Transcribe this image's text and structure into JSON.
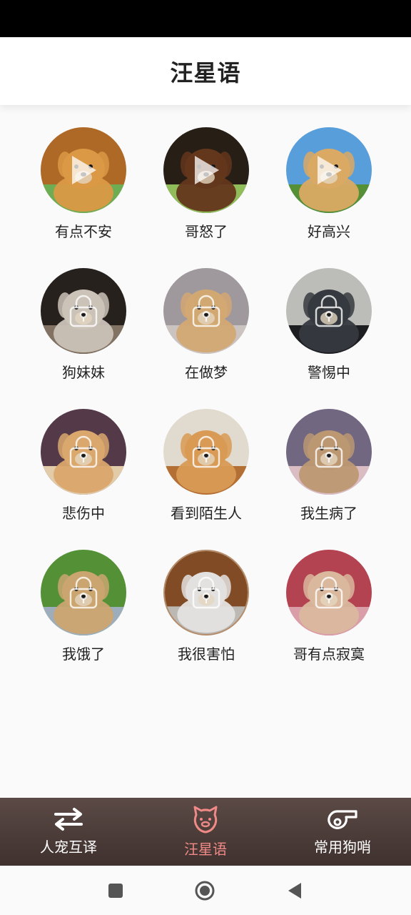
{
  "app": {
    "title": "汪星语"
  },
  "items": [
    {
      "label": "有点不安",
      "state": "play",
      "palette": [
        "#e9a24a",
        "#b9702a",
        "#74b85a"
      ]
    },
    {
      "label": "哥怒了",
      "state": "play",
      "palette": [
        "#6a3b1e",
        "#2a2018",
        "#9ac860"
      ]
    },
    {
      "label": "好高兴",
      "state": "play",
      "palette": [
        "#e8b46a",
        "#5ea8e8",
        "#5c9a3a"
      ]
    },
    {
      "label": "狗妹妹",
      "state": "locked",
      "palette": [
        "#d8cfc4",
        "#2a2420",
        "#8a7a6a"
      ]
    },
    {
      "label": "在做梦",
      "state": "locked",
      "palette": [
        "#e0b37a",
        "#a9a3a8",
        "#d8d0cc"
      ]
    },
    {
      "label": "警惕中",
      "state": "locked",
      "palette": [
        "#3a3e44",
        "#c8c8c4",
        "#1e2024"
      ]
    },
    {
      "label": "悲伤中",
      "state": "locked",
      "palette": [
        "#e8b274",
        "#5a3e4e",
        "#f0d8b4"
      ]
    },
    {
      "label": "看到陌生人",
      "state": "locked",
      "palette": [
        "#e6a45a",
        "#f0e8dc",
        "#c07838"
      ]
    },
    {
      "label": "我生病了",
      "state": "locked",
      "palette": [
        "#c8a27a",
        "#7a6e8a",
        "#e8c8d0"
      ]
    },
    {
      "label": "我饿了",
      "state": "locked",
      "palette": [
        "#d8b078",
        "#5a9a3a",
        "#a8b8c8"
      ]
    },
    {
      "label": "我很害怕",
      "state": "locked",
      "palette": [
        "#f2f0ee",
        "#8a5028",
        "#c8c4c0"
      ]
    },
    {
      "label": "哥有点寂寞",
      "state": "locked",
      "palette": [
        "#e8c4a8",
        "#c04858",
        "#e8a8b4"
      ]
    }
  ],
  "bottom_nav": {
    "items": [
      {
        "label": "人宠互译",
        "icon": "swap-arrows-icon",
        "active": false
      },
      {
        "label": "汪星语",
        "icon": "pet-face-icon",
        "active": true
      },
      {
        "label": "常用狗哨",
        "icon": "whistle-icon",
        "active": false
      }
    ],
    "active_color": "#f08a87"
  },
  "system_nav": {
    "icons": [
      "square-recents-icon",
      "circle-home-icon",
      "triangle-back-icon"
    ]
  }
}
